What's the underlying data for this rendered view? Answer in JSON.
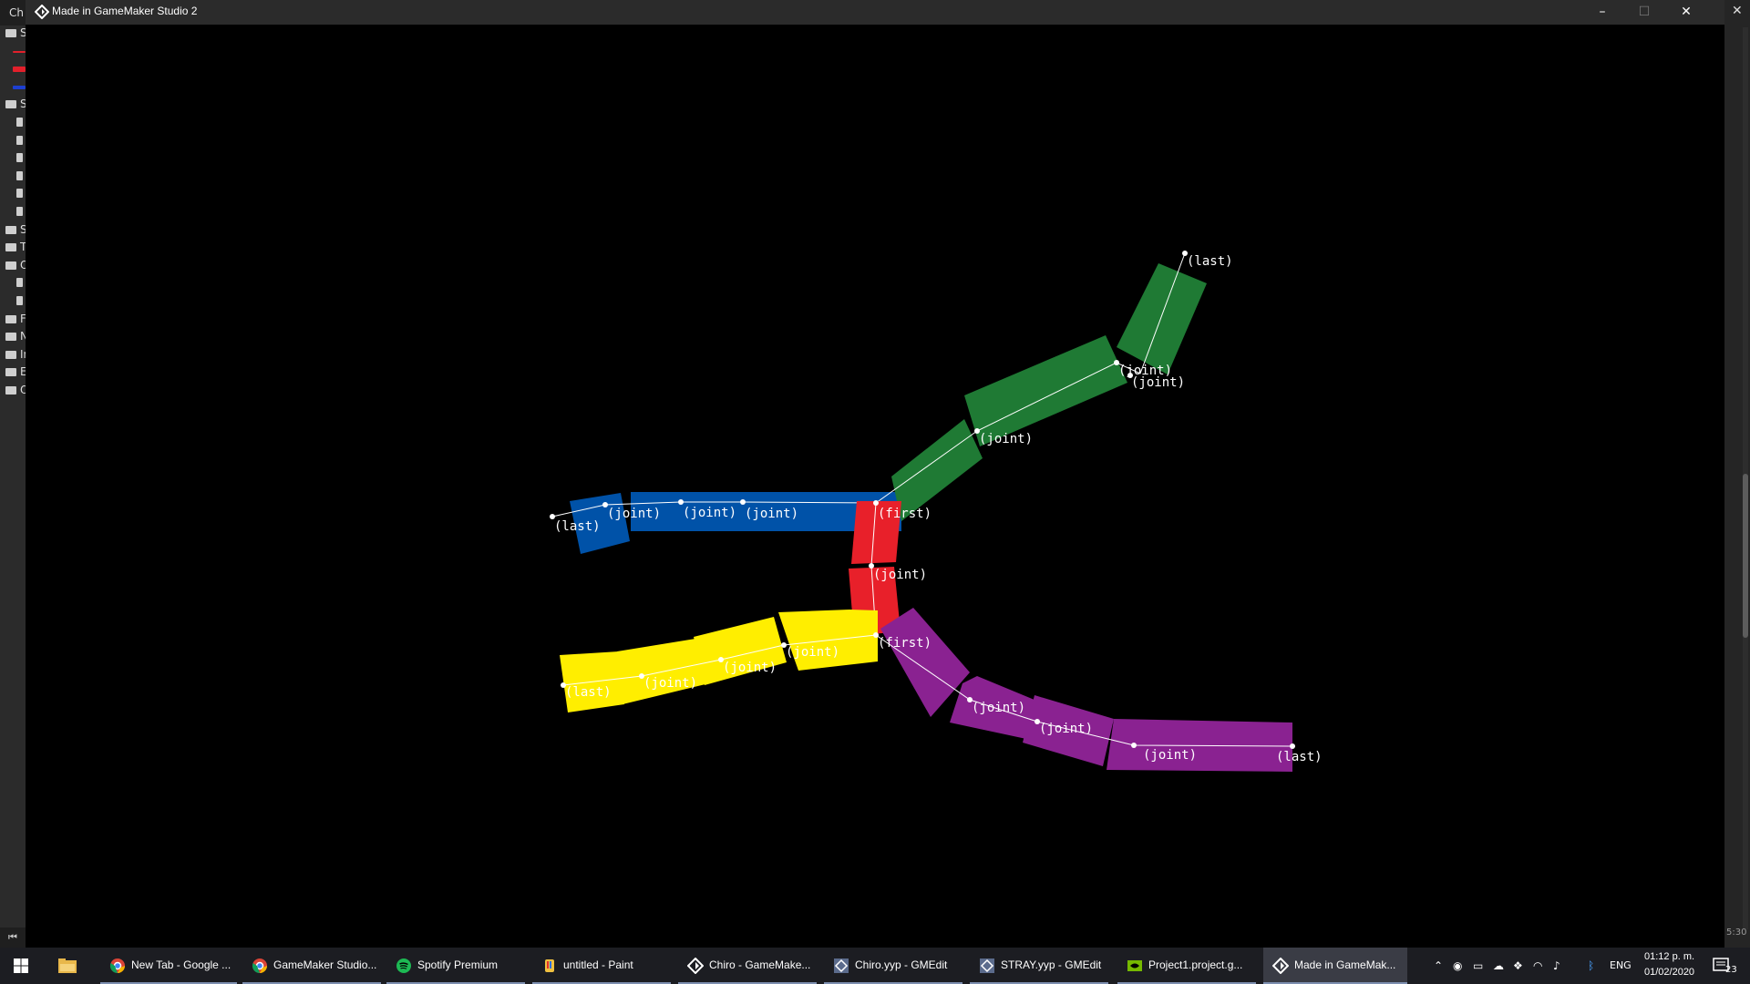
{
  "window": {
    "title": "Made in GameMaker Studio 2",
    "minimize": "–",
    "maximize": "☐",
    "close": "✕"
  },
  "ide_left": {
    "top_text": "Ch",
    "rows": [
      {
        "kind": "folder-open",
        "text": "S"
      },
      {
        "kind": "redline",
        "text": ""
      },
      {
        "kind": "red",
        "text": ""
      },
      {
        "kind": "blue",
        "text": ""
      },
      {
        "kind": "folder-open",
        "text": "S"
      },
      {
        "kind": "file",
        "text": ""
      },
      {
        "kind": "file",
        "text": ""
      },
      {
        "kind": "file",
        "text": ""
      },
      {
        "kind": "file",
        "text": ""
      },
      {
        "kind": "file",
        "text": ""
      },
      {
        "kind": "file",
        "text": ""
      },
      {
        "kind": "folder",
        "text": "S"
      },
      {
        "kind": "folder",
        "text": "T"
      },
      {
        "kind": "folder-open",
        "text": "O"
      },
      {
        "kind": "file",
        "text": ""
      },
      {
        "kind": "file",
        "text": ""
      },
      {
        "kind": "folder",
        "text": "F"
      },
      {
        "kind": "folder",
        "text": "N"
      },
      {
        "kind": "folder",
        "text": "In"
      },
      {
        "kind": "folder",
        "text": "E"
      },
      {
        "kind": "folder",
        "text": "O"
      }
    ],
    "rewind_icon": "⏮"
  },
  "ide_right": {
    "close_x": "✕",
    "time_snippet": "5:30"
  },
  "scene": {
    "colors": {
      "blue": "#0052a8",
      "green": "#1f7a34",
      "red": "#e8202a",
      "yellow": "#ffee00",
      "purple": "#8a2291"
    },
    "labels": {
      "first": "(first)",
      "joint": "(joint)",
      "last": "(last)"
    },
    "overlap_label": "(first)"
  },
  "taskbar": {
    "apps": [
      {
        "label": "New Tab - Google ...",
        "icon": "chrome-icon"
      },
      {
        "label": "GameMaker Studio...",
        "icon": "chrome-icon"
      },
      {
        "label": "Spotify Premium",
        "icon": "spotify-icon"
      },
      {
        "label": "untitled - Paint",
        "icon": "paint-icon"
      },
      {
        "label": "Chiro - GameMake...",
        "icon": "gamemaker-icon"
      },
      {
        "label": "Chiro.yyp - GMEdit",
        "icon": "gmedit-icon"
      },
      {
        "label": "STRAY.yyp - GMEdit",
        "icon": "gmedit-icon"
      },
      {
        "label": "Project1.project.g...",
        "icon": "nvidia-icon"
      },
      {
        "label": "Made in GameMak...",
        "icon": "gamemaker-icon"
      }
    ],
    "tray": {
      "language": "ENG",
      "time": "01:12 p. m.",
      "date": "01/02/2020",
      "notifications": "23"
    }
  }
}
